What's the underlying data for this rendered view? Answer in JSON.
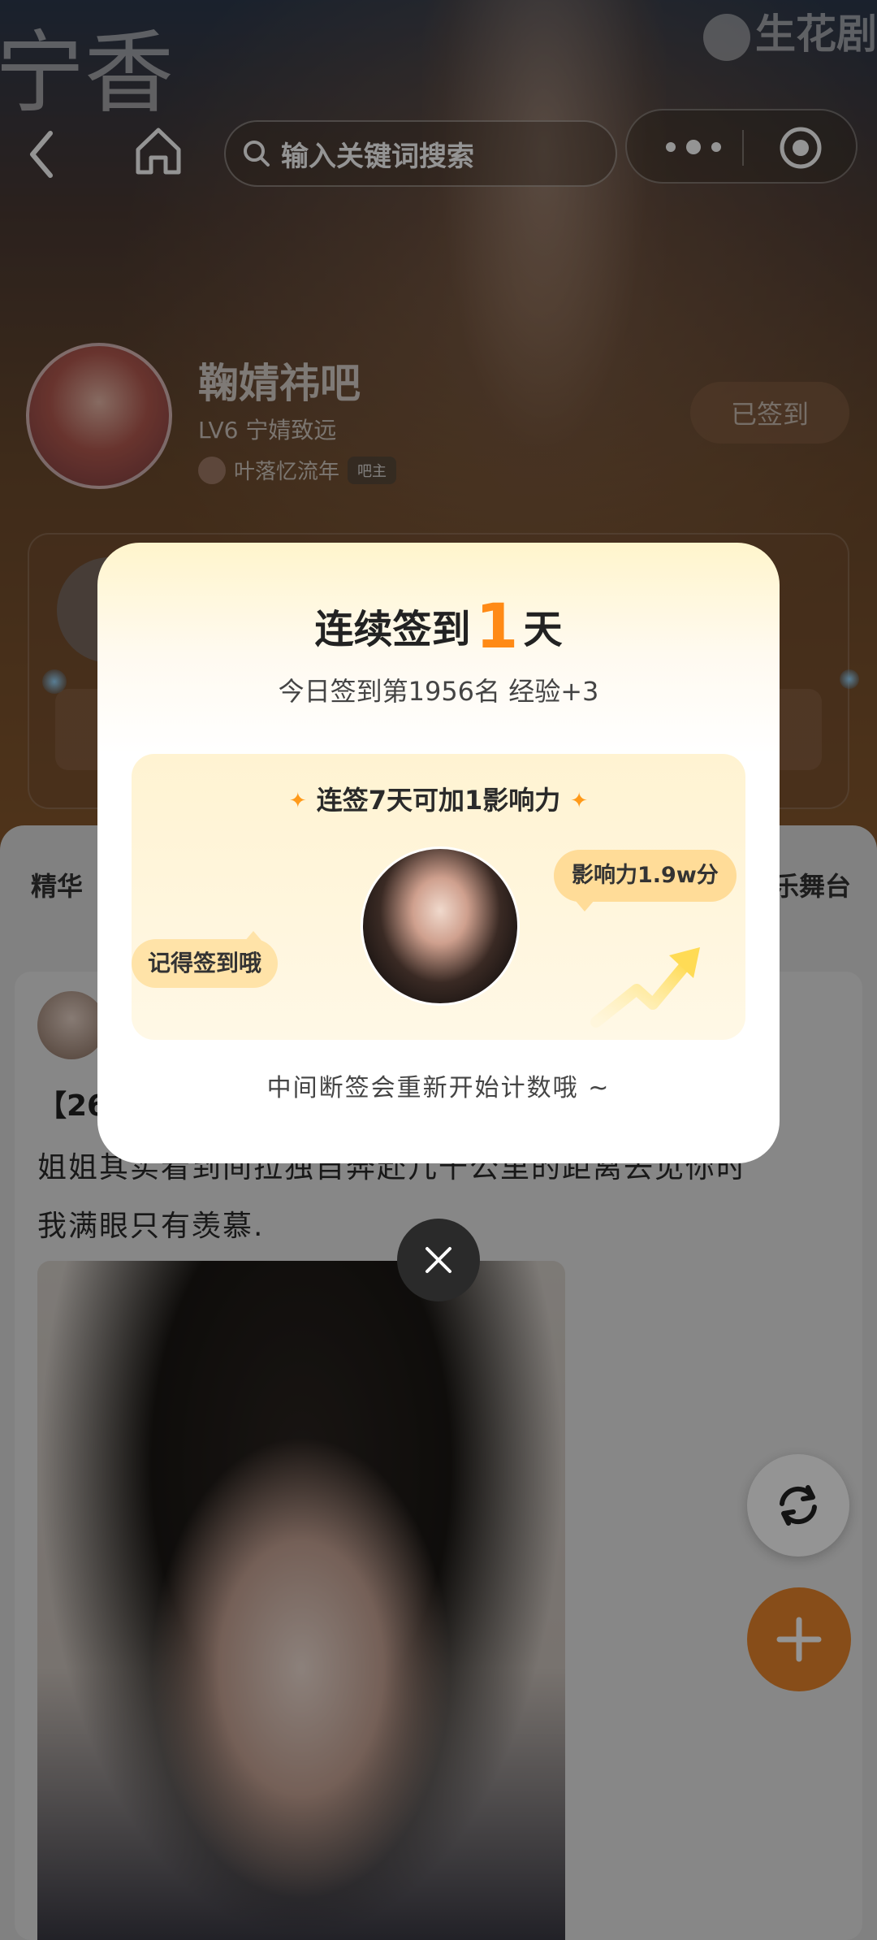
{
  "header": {
    "calligraphy": "宁香",
    "watermark": "生花剧",
    "search_placeholder": "输入关键词搜索"
  },
  "forum": {
    "title": "鞠婧祎吧",
    "level": "LV6 宁婧致远",
    "owner_name": "叶落忆流年",
    "owner_tag": "吧主",
    "signed_label": "已签到"
  },
  "tabs": [
    {
      "label": "精华"
    },
    {
      "label": "乐舞台"
    }
  ],
  "post": {
    "line1": "【26",
    "line2": "姐姐其实看到间拉独自奔赴几千公里的距离去见你时",
    "line3": "我满眼只有羡慕."
  },
  "modal": {
    "title_prefix": "连续签到",
    "title_days": "1",
    "title_suffix": "天",
    "subtitle": "今日签到第1956名 经验+3",
    "reward_title": "连签7天可加1影响力",
    "remind_bubble": "记得签到哦",
    "influence_bubble": "影响力1.9w分",
    "footer": "中间断签会重新开始计数哦 ~"
  },
  "colors": {
    "accent_orange": "#ff8a16",
    "fab_orange": "#e8862c"
  },
  "icons": {
    "back": "back-arrow-icon",
    "home": "home-icon",
    "search": "search-icon",
    "more": "more-dots-icon",
    "target": "target-icon",
    "refresh": "refresh-icon",
    "add": "plus-icon",
    "close": "close-icon"
  }
}
